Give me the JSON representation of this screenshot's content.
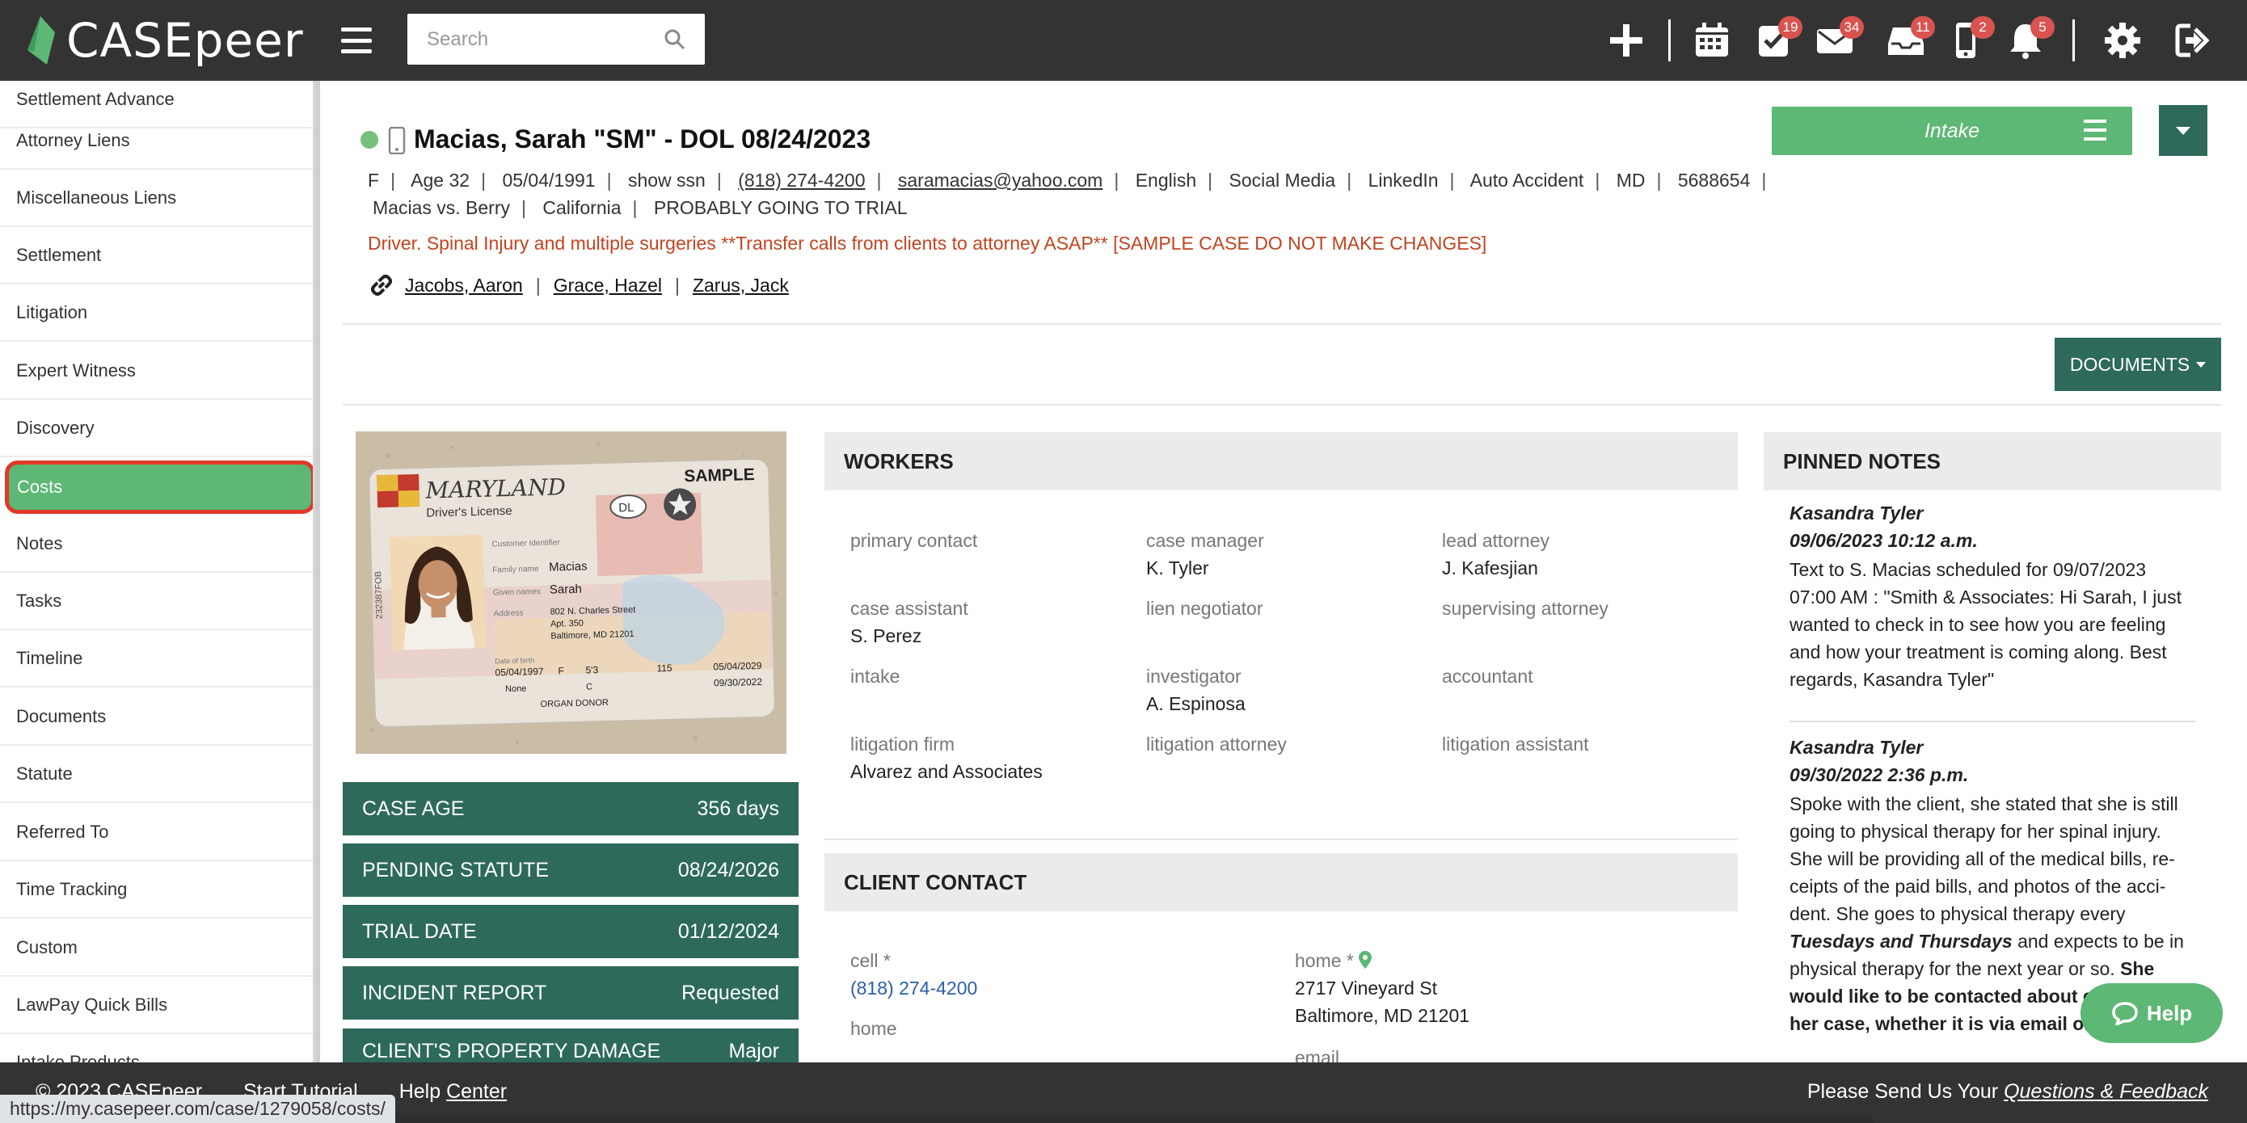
{
  "app": {
    "name": "CASEpeer"
  },
  "search": {
    "placeholder": "Search"
  },
  "nav": {
    "add_icon": "plus-icon",
    "badges": {
      "tasks": "19",
      "messages": "34",
      "inbox": "11",
      "texts": "2",
      "notifications": "5"
    }
  },
  "sidebar": {
    "items": [
      "Settlement Advance",
      "Attorney Liens",
      "Miscellaneous Liens",
      "Settlement",
      "Litigation",
      "Expert Witness",
      "Discovery",
      "Costs",
      "Notes",
      "Tasks",
      "Timeline",
      "Documents",
      "Statute",
      "Referred To",
      "Time Tracking",
      "Custom",
      "LawPay Quick Bills",
      "Intake Products"
    ],
    "active": "Costs"
  },
  "case": {
    "title": "Macias, Sarah \"SM\" - DOL 08/24/2023",
    "gender": "F",
    "age": "Age 32",
    "dob": "05/04/1991",
    "ssn": "show ssn",
    "phone": "(818) 274-4200",
    "email": "saramacias@yahoo.com",
    "language": "English",
    "source": "Social Media",
    "source_detail": "LinkedIn",
    "case_type": "Auto Accident",
    "state_code": "MD",
    "case_number": "5688654",
    "case_name": "Macias vs. Berry",
    "venue": "California",
    "outlook": "PROBABLY GOING TO TRIAL",
    "description": "Driver. Spinal Injury and multiple surgeries **Transfer calls from clients to attorney ASAP** [SAMPLE CASE DO NOT MAKE CHANGES]",
    "linked": [
      "Jacobs, Aaron",
      "Grace, Hazel",
      "Zarus, Jack"
    ]
  },
  "buttons": {
    "intake": "Intake",
    "documents": "DOCUMENTS"
  },
  "license": {
    "state": "MARYLAND",
    "type": "Driver's License",
    "sample": "SAMPLE",
    "dl": "DL",
    "family_label": "Family name",
    "family": "Macias",
    "given_label": "Given names",
    "given": "Sarah",
    "address_label": "Address",
    "address1": "802 N. Charles Street",
    "address2": "Apt. 350",
    "address3": "Baltimore, MD 21201",
    "dob_label": "Date of birth",
    "dob": "05/04/1997",
    "sex": "F",
    "height": "5'3",
    "weight": "115",
    "issue": "05/04/2029",
    "expiry": "09/30/2022",
    "restrictions": "None",
    "class": "C",
    "donor": "ORGAN DONOR",
    "side_number": "232387FOB"
  },
  "stats": [
    {
      "label": "CASE AGE",
      "value": "356 days"
    },
    {
      "label": "PENDING STATUTE",
      "value": "08/24/2026"
    },
    {
      "label": "TRIAL DATE",
      "value": "01/12/2024"
    },
    {
      "label": "INCIDENT REPORT",
      "value": "Requested"
    },
    {
      "label": "CLIENT'S PROPERTY DAMAGE",
      "value": "Major"
    }
  ],
  "workers": {
    "title": "WORKERS",
    "primary_contact": {
      "label": "primary contact",
      "value": ""
    },
    "case_manager": {
      "label": "case manager",
      "value": "K. Tyler"
    },
    "lead_attorney": {
      "label": "lead attorney",
      "value": "J. Kafesjian"
    },
    "case_assistant": {
      "label": "case assistant",
      "value": "S. Perez"
    },
    "lien_negotiator": {
      "label": "lien negotiator",
      "value": ""
    },
    "supervising_attorney": {
      "label": "supervising attorney",
      "value": ""
    },
    "intake": {
      "label": "intake",
      "value": ""
    },
    "investigator": {
      "label": "investigator",
      "value": "A. Espinosa"
    },
    "accountant": {
      "label": "accountant",
      "value": ""
    },
    "litigation_firm": {
      "label": "litigation firm",
      "value": "Alvarez and Associates"
    },
    "litigation_attorney": {
      "label": "litigation attorney",
      "value": ""
    },
    "litigation_assistant": {
      "label": "litigation assistant",
      "value": ""
    }
  },
  "client_contact": {
    "title": "CLIENT CONTACT",
    "cell_label": "cell *",
    "cell": "(818) 274-4200",
    "home_label": "home *",
    "home_address1": "2717 Vineyard St",
    "home_address2": "Baltimore, MD 21201",
    "home2_label": "home",
    "email_label": "email"
  },
  "pinned": {
    "title": "PINNED NOTES",
    "notes": [
      {
        "author": "Kasandra Tyler",
        "time": "09/06/2023 10:12 a.m.",
        "lines": [
          "Text to S. Macias scheduled for 09/07/2023",
          "07:00 AM : \"Smith & Associates: Hi Sarah, I just",
          "wanted to check in to see how you are feeling",
          "and how your treatment is coming along. Best",
          "regards, Kasandra Tyler\""
        ]
      },
      {
        "author": "Kasandra Tyler",
        "time": "09/30/2022 2:36 p.m.",
        "lines": [
          "Spoke with the client, she stated that she is still",
          "going to physical therapy for her spinal injury.",
          "She will be providing all of the medical bills, re-",
          "ceipts of the paid bills, and photos of the acci-",
          "dent. She goes to physical therapy every"
        ],
        "em": "Tuesdays and Thursdays",
        "after_em": " and expects to be in",
        "line7a": "physical therapy for the next year or so. ",
        "line7b": "She",
        "bold1": "would like to be contacted about e",
        "bold2": "her case, whether it is via email or"
      }
    ]
  },
  "help": {
    "label": "Help"
  },
  "footer": {
    "copyright": "© 2023 CASEpeer",
    "tutorial": "Start Tutorial",
    "help_prefix": "Help ",
    "help_link": "Center",
    "feedback_prefix": "Please Send Us Your ",
    "feedback_link": "Questions & Feedback"
  },
  "status_url": "https://my.casepeer.com/case/1279058/costs/",
  "colors": {
    "brand_dark": "#333333",
    "accent_green": "#5cb874",
    "teal": "#2d6a5b",
    "badge_red": "#d9534f",
    "alert_red": "#c2441f",
    "highlight": "#e0392b"
  }
}
